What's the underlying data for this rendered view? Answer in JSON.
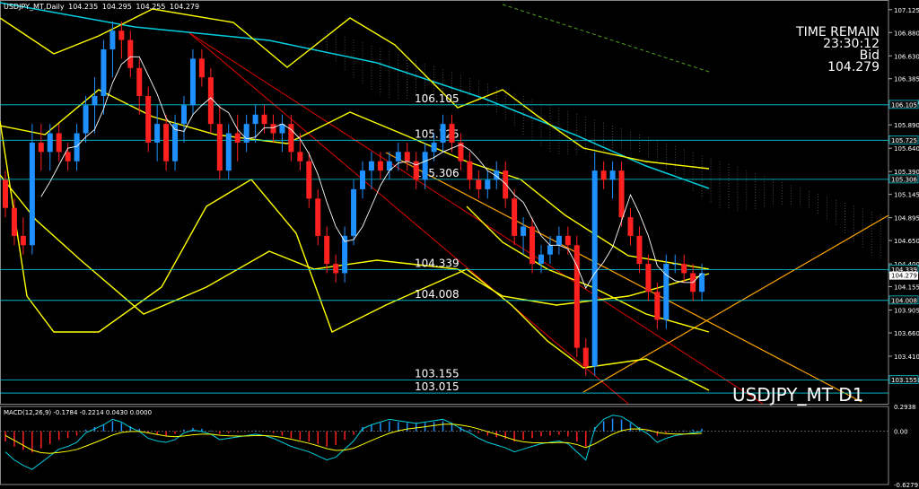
{
  "header": {
    "symbol": "USDJPY_MT,Daily",
    "ohlc": [
      "104.235",
      "104.295",
      "104.255",
      "104.279"
    ]
  },
  "timer": {
    "title": "TIME REMAIN",
    "time": "23:30:12",
    "side": "Bid",
    "price": "104.279"
  },
  "symbol_label": "USDJPY_MT D1",
  "colors": {
    "bull": "#1e90ff",
    "bear": "#ff2020",
    "yellow": "#ffff00",
    "cyan": "#00cfe0",
    "red_line": "#e00000",
    "orange": "#ffa500",
    "green_dash": "#4fa020",
    "gray": "#bbbbbb"
  },
  "chart_data": [
    {
      "type": "candlestick",
      "title": "USDJPY_MT,Daily",
      "ylim": [
        102.9,
        107.2
      ],
      "y_ticks": [
        "107.125",
        "106.880",
        "106.630",
        "106.385",
        "106.135",
        "105.890",
        "105.640",
        "105.390",
        "105.145",
        "104.895",
        "104.650",
        "104.400",
        "104.155",
        "103.905",
        "103.660",
        "103.410",
        "103.160"
      ],
      "levels": [
        {
          "value": 106.105,
          "label": "106.105",
          "tag": "106.105"
        },
        {
          "value": 105.725,
          "label": "105.725",
          "tag": "105.725"
        },
        {
          "value": 105.306,
          "label": "105.306",
          "tag": "105.306"
        },
        {
          "value": 104.339,
          "label": "104.339",
          "tag": "104.339"
        },
        {
          "value": 104.008,
          "label": "104.008",
          "tag": "104.008"
        },
        {
          "value": 103.155,
          "label": "103.155",
          "tag": "103.155"
        },
        {
          "value": 103.015,
          "label": "103.015",
          "tag": ""
        }
      ],
      "current_price_tag": "104.279",
      "candles": [
        [
          105.3,
          105.4,
          104.9,
          105.0
        ],
        [
          105.0,
          105.1,
          104.6,
          104.7
        ],
        [
          104.7,
          104.9,
          104.5,
          104.6
        ],
        [
          104.6,
          105.9,
          104.5,
          105.7
        ],
        [
          105.7,
          105.9,
          105.4,
          105.6
        ],
        [
          105.6,
          105.9,
          105.4,
          105.8
        ],
        [
          105.8,
          105.9,
          105.5,
          105.6
        ],
        [
          105.6,
          105.7,
          105.4,
          105.5
        ],
        [
          105.5,
          105.9,
          105.4,
          105.8
        ],
        [
          105.8,
          106.2,
          105.7,
          106.1
        ],
        [
          106.1,
          106.4,
          105.8,
          106.2
        ],
        [
          106.2,
          106.8,
          106.0,
          106.7
        ],
        [
          106.7,
          107.0,
          106.4,
          106.9
        ],
        [
          106.9,
          107.0,
          106.6,
          106.8
        ],
        [
          106.8,
          106.9,
          106.4,
          106.5
        ],
        [
          106.5,
          106.6,
          106.0,
          106.2
        ],
        [
          106.2,
          106.3,
          105.6,
          105.7
        ],
        [
          105.7,
          106.1,
          105.5,
          105.9
        ],
        [
          105.9,
          106.0,
          105.4,
          105.5
        ],
        [
          105.5,
          106.0,
          105.4,
          105.9
        ],
        [
          105.9,
          106.2,
          105.7,
          106.1
        ],
        [
          106.1,
          106.7,
          106.0,
          106.6
        ],
        [
          106.6,
          106.7,
          106.3,
          106.4
        ],
        [
          106.4,
          106.5,
          105.8,
          105.9
        ],
        [
          105.9,
          106.1,
          105.3,
          105.4
        ],
        [
          105.4,
          105.9,
          105.3,
          105.8
        ],
        [
          105.8,
          106.0,
          105.5,
          105.7
        ],
        [
          105.7,
          106.0,
          105.6,
          105.9
        ],
        [
          105.9,
          106.1,
          105.7,
          106.0
        ],
        [
          106.0,
          106.1,
          105.8,
          105.9
        ],
        [
          105.9,
          106.0,
          105.7,
          105.8
        ],
        [
          105.8,
          106.0,
          105.6,
          105.9
        ],
        [
          105.9,
          106.0,
          105.5,
          105.6
        ],
        [
          105.6,
          105.8,
          105.4,
          105.5
        ],
        [
          105.5,
          105.6,
          105.0,
          105.1
        ],
        [
          105.1,
          105.2,
          104.6,
          104.7
        ],
        [
          104.7,
          104.8,
          104.3,
          104.4
        ],
        [
          104.4,
          104.5,
          104.2,
          104.3
        ],
        [
          104.3,
          104.8,
          104.2,
          104.7
        ],
        [
          104.7,
          105.3,
          104.6,
          105.2
        ],
        [
          105.2,
          105.5,
          105.1,
          105.4
        ],
        [
          105.4,
          105.6,
          105.2,
          105.5
        ],
        [
          105.5,
          105.6,
          105.3,
          105.4
        ],
        [
          105.4,
          105.6,
          105.3,
          105.5
        ],
        [
          105.5,
          105.7,
          105.4,
          105.6
        ],
        [
          105.6,
          105.7,
          105.4,
          105.5
        ],
        [
          105.5,
          105.6,
          105.2,
          105.3
        ],
        [
          105.3,
          105.7,
          105.2,
          105.6
        ],
        [
          105.6,
          105.8,
          105.5,
          105.7
        ],
        [
          105.7,
          106.0,
          105.6,
          105.9
        ],
        [
          105.9,
          106.0,
          105.6,
          105.7
        ],
        [
          105.7,
          105.8,
          105.4,
          105.5
        ],
        [
          105.5,
          105.6,
          105.2,
          105.3
        ],
        [
          105.3,
          105.4,
          105.1,
          105.2
        ],
        [
          105.2,
          105.4,
          105.1,
          105.3
        ],
        [
          105.3,
          105.5,
          105.2,
          105.4
        ],
        [
          105.4,
          105.5,
          105.0,
          105.1
        ],
        [
          105.1,
          105.2,
          104.6,
          104.7
        ],
        [
          104.7,
          104.9,
          104.5,
          104.8
        ],
        [
          104.8,
          104.9,
          104.3,
          104.4
        ],
        [
          104.4,
          104.6,
          104.3,
          104.5
        ],
        [
          104.5,
          104.7,
          104.4,
          104.6
        ],
        [
          104.6,
          104.8,
          104.5,
          104.7
        ],
        [
          104.7,
          104.8,
          104.5,
          104.6
        ],
        [
          104.6,
          104.7,
          103.4,
          103.5
        ],
        [
          103.5,
          103.6,
          103.2,
          103.3
        ],
        [
          103.3,
          105.6,
          103.2,
          105.4
        ],
        [
          105.4,
          105.5,
          105.2,
          105.3
        ],
        [
          105.3,
          105.5,
          105.1,
          105.4
        ],
        [
          105.4,
          105.5,
          104.8,
          104.9
        ],
        [
          104.9,
          105.0,
          104.6,
          104.7
        ],
        [
          104.7,
          104.8,
          104.3,
          104.4
        ],
        [
          104.4,
          104.5,
          104.0,
          104.1
        ],
        [
          104.1,
          104.2,
          103.7,
          103.8
        ],
        [
          103.8,
          104.5,
          103.7,
          104.4
        ],
        [
          104.4,
          104.5,
          104.3,
          104.4
        ],
        [
          104.4,
          104.5,
          104.2,
          104.3
        ],
        [
          104.3,
          104.4,
          104.0,
          104.1
        ],
        [
          104.1,
          104.4,
          104.0,
          104.3
        ]
      ]
    },
    {
      "type": "histogram",
      "title": "MACD(12,26,9) -0.1784 -0.2214 0.0430 0.0000",
      "ylim": [
        -0.6279,
        0.2938
      ],
      "y_ticks": [
        "0.2938",
        "0.00",
        "-0.6279"
      ],
      "histogram": [
        -0.12,
        -0.18,
        -0.22,
        -0.25,
        -0.2,
        -0.15,
        -0.1,
        -0.08,
        -0.05,
        0.02,
        0.05,
        0.08,
        0.12,
        0.1,
        0.06,
        0.03,
        -0.02,
        -0.04,
        -0.05,
        -0.03,
        0.02,
        0.04,
        0.03,
        0.01,
        -0.03,
        -0.02,
        -0.01,
        0.0,
        0.01,
        0.0,
        -0.02,
        -0.05,
        -0.08,
        -0.1,
        -0.12,
        -0.15,
        -0.18,
        -0.16,
        -0.1,
        -0.04,
        0.05,
        0.08,
        0.1,
        0.12,
        0.11,
        0.1,
        0.09,
        0.1,
        0.11,
        0.12,
        0.09,
        0.05,
        0.02,
        -0.02,
        -0.05,
        -0.07,
        -0.09,
        -0.12,
        -0.1,
        -0.08,
        -0.06,
        -0.05,
        -0.04,
        -0.06,
        -0.12,
        -0.18,
        0.05,
        0.12,
        0.15,
        0.14,
        0.1,
        0.05,
        0.01,
        -0.05,
        -0.02,
        0.0,
        0.01,
        0.02,
        0.03
      ]
    }
  ]
}
